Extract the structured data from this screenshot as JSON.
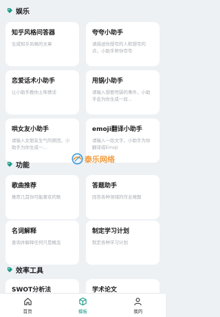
{
  "sections": [
    {
      "title": "娱乐",
      "cards": [
        {
          "title": "知乎风格问答器",
          "desc": "生成知乎风格的文章"
        },
        {
          "title": "夸夸小助手",
          "desc": "请描述你想夸的人和想夸的点，小助手帮你夸夸"
        },
        {
          "title": "恋爱话术小助手",
          "desc": "让小助手教你土味情话"
        },
        {
          "title": "甩锅小助手",
          "desc": "请输入想要甩锅的事件，小助手会为你生成一段..."
        },
        {
          "title": "哄女友小助手",
          "desc": "请输入女朋友生气的原因，小助手为你生成一..."
        },
        {
          "title": "emoji翻译小助手",
          "desc": "请输入一段文字，小助手为你翻译成Emoji"
        }
      ]
    },
    {
      "title": "功能",
      "cards": [
        {
          "title": "歌曲推荐",
          "desc": "推荐几首你可能喜欢的歌"
        },
        {
          "title": "答题助手",
          "desc": "回答各种领域的作业难题"
        },
        {
          "title": "名词解释",
          "desc": "查询并解释任何只是概念"
        },
        {
          "title": "制定学习计划",
          "desc": "制定各种学习计划"
        }
      ]
    },
    {
      "title": "效率工具",
      "cards": [
        {
          "title": "SWOT分析法",
          "desc": ""
        },
        {
          "title": "学术论文",
          "desc": ""
        }
      ]
    }
  ],
  "tabbar": {
    "items": [
      {
        "label": "首页",
        "icon": "home-icon",
        "active": false
      },
      {
        "label": "模板",
        "icon": "template-cube-icon",
        "active": true
      },
      {
        "label": "我的",
        "icon": "user-icon",
        "active": false
      }
    ]
  },
  "watermark": {
    "text": "泰乐网络"
  },
  "colors": {
    "accent": "#1a9a86",
    "background": "#eef1f4",
    "card": "#ffffff",
    "muted_text": "#a9adb3",
    "watermark": "#f08a1c"
  }
}
